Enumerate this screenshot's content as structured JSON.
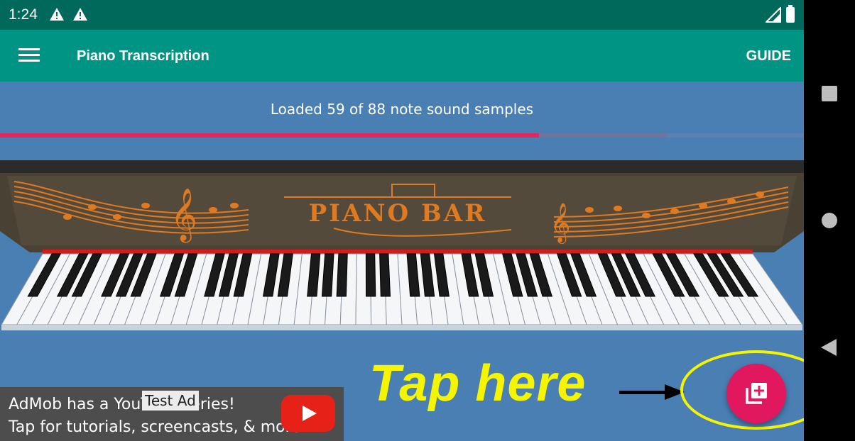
{
  "status_bar": {
    "time": "1:24"
  },
  "app_bar": {
    "title": "Piano Transcription",
    "guide_label": "GUIDE"
  },
  "loading": {
    "text": "Loaded 59 of 88 note sound samples",
    "loaded": 59,
    "total": 88,
    "buffer_fraction": 0.83
  },
  "piano": {
    "brand_text": "PIANO BAR"
  },
  "ad": {
    "line1": "AdMob has a YouTube series!",
    "line2": "Tap for tutorials, screencasts, & more.",
    "tag": "Test Ad"
  },
  "annotation": {
    "text": "Tap here"
  },
  "icons": {
    "menu": "menu-icon",
    "fab": "add-to-library-icon",
    "youtube": "youtube-play-icon",
    "warning": "warning-icon",
    "signal": "signal-icon",
    "battery": "battery-icon"
  },
  "colors": {
    "status_bar": "#00695c",
    "app_bar": "#009485",
    "background": "#4a7fb4",
    "progress": "#e0285f",
    "fab": "#e2185f",
    "annotation": "#f5f500"
  }
}
